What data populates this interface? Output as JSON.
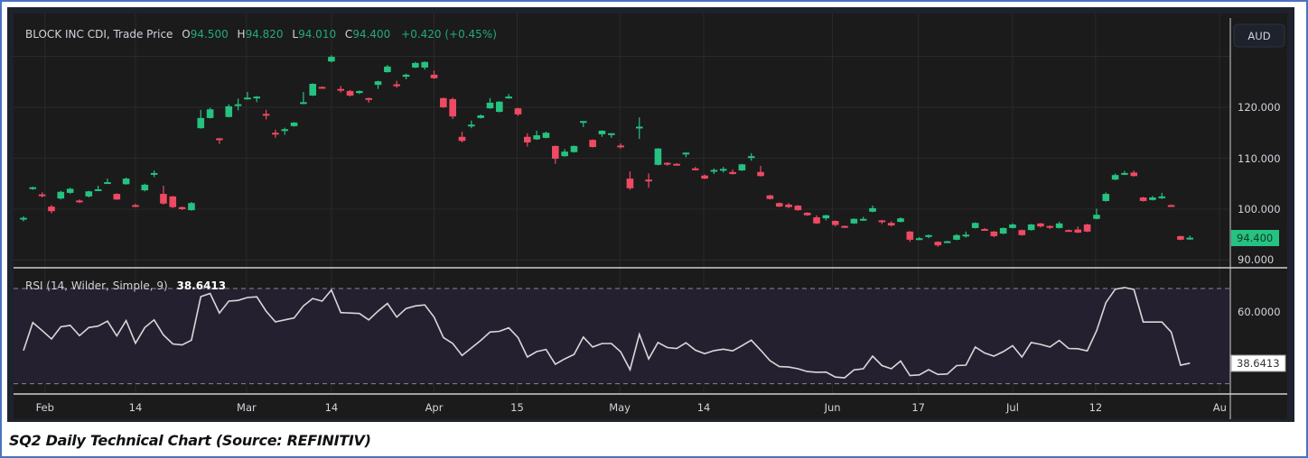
{
  "header": {
    "symbol": "BLOCK INC CDI, Trade Price",
    "o_label": "O",
    "o_value": "94.500",
    "h_label": "H",
    "h_value": "94.820",
    "l_label": "L",
    "l_value": "94.010",
    "c_label": "C",
    "c_value": "94.400",
    "change": "+0.420 (+0.45%)"
  },
  "currency_button": "AUD",
  "price_axis_labels": [
    "120.000",
    "110.000",
    "100.000",
    "90.000"
  ],
  "last_price_tag": "94.400",
  "rsi": {
    "label": "RSI (14, Wilder, Simple, 9)",
    "value": "38.6413",
    "axis_label": "60.0000",
    "tag": "38.6413"
  },
  "caption": "SQ2 Daily Technical Chart (Source: REFINITIV)",
  "colors": {
    "up": "#26c281",
    "down": "#ef4a63",
    "background": "#1b1b1b",
    "rsi_line": "#d8d8d8",
    "rsi_band": "#252030"
  },
  "chart_data": [
    {
      "type": "candlestick",
      "title": "BLOCK INC CDI, Trade Price",
      "ylabel": "AUD",
      "ylim": [
        88,
        134
      ],
      "yticks": [
        90,
        100,
        110,
        120,
        130
      ],
      "x_tick_labels": [
        {
          "label": "Feb",
          "index": 2.3
        },
        {
          "label": "14",
          "index": 12
        },
        {
          "label": "Mar",
          "index": 23.9
        },
        {
          "label": "14",
          "index": 33
        },
        {
          "label": "Apr",
          "index": 44
        },
        {
          "label": "15",
          "index": 52.9
        },
        {
          "label": "May",
          "index": 63.9
        },
        {
          "label": "14",
          "index": 72.9
        },
        {
          "label": "Jun",
          "index": 86.7
        },
        {
          "label": "17",
          "index": 95.9
        },
        {
          "label": "Jul",
          "index": 106
        },
        {
          "label": "12",
          "index": 114.9
        },
        {
          "label": "Au",
          "index": 128.2
        }
      ],
      "ohlc": [
        [
          98.0,
          98.6,
          97.6,
          98.3
        ],
        [
          104.0,
          104.4,
          103.8,
          104.3
        ],
        [
          102.9,
          103.3,
          102.3,
          102.7
        ],
        [
          100.5,
          100.8,
          99.2,
          99.6
        ],
        [
          102.1,
          103.6,
          101.9,
          103.4
        ],
        [
          103.2,
          104.2,
          103.0,
          104.0
        ],
        [
          101.7,
          101.9,
          101.2,
          101.4
        ],
        [
          102.5,
          103.6,
          102.3,
          103.5
        ],
        [
          103.8,
          104.6,
          103.7,
          103.9
        ],
        [
          105.1,
          106.0,
          105.0,
          105.3
        ],
        [
          103.0,
          103.1,
          101.8,
          101.9
        ],
        [
          104.9,
          106.2,
          104.8,
          106.0
        ],
        [
          100.8,
          101.1,
          100.4,
          100.6
        ],
        [
          103.7,
          105.0,
          103.5,
          104.8
        ],
        [
          106.9,
          107.6,
          106.3,
          107.1
        ],
        [
          103.0,
          104.6,
          100.9,
          101.1
        ],
        [
          102.5,
          102.6,
          100.2,
          100.4
        ],
        [
          100.4,
          100.5,
          99.8,
          100.0
        ],
        [
          99.8,
          101.4,
          99.7,
          101.2
        ],
        [
          115.9,
          119.5,
          115.8,
          117.9
        ],
        [
          117.9,
          119.9,
          117.8,
          119.6
        ],
        [
          113.9,
          114.0,
          112.8,
          113.7
        ],
        [
          118.1,
          120.6,
          118.0,
          120.2
        ],
        [
          120.3,
          121.7,
          119.4,
          120.6
        ],
        [
          121.7,
          123.0,
          121.5,
          121.9
        ],
        [
          121.9,
          122.2,
          121.0,
          122.1
        ],
        [
          118.7,
          119.5,
          117.6,
          118.5
        ],
        [
          115.0,
          115.6,
          114.0,
          114.8
        ],
        [
          115.4,
          116.0,
          114.6,
          115.7
        ],
        [
          116.3,
          117.1,
          116.2,
          117.0
        ],
        [
          120.7,
          123.0,
          120.6,
          121.0
        ],
        [
          122.3,
          124.7,
          122.2,
          124.6
        ],
        [
          124.0,
          124.1,
          123.7,
          123.8
        ],
        [
          129.0,
          130.2,
          128.8,
          129.9
        ],
        [
          123.6,
          124.2,
          122.9,
          123.4
        ],
        [
          123.2,
          123.4,
          122.1,
          122.3
        ],
        [
          122.8,
          123.3,
          122.6,
          123.2
        ],
        [
          121.8,
          121.9,
          120.9,
          121.6
        ],
        [
          124.4,
          125.2,
          123.6,
          125.1
        ],
        [
          126.9,
          128.3,
          126.8,
          128.0
        ],
        [
          124.5,
          125.2,
          123.8,
          124.3
        ],
        [
          126.0,
          126.6,
          125.5,
          126.4
        ],
        [
          127.8,
          128.9,
          127.7,
          128.7
        ],
        [
          127.8,
          129.0,
          127.4,
          128.9
        ],
        [
          126.4,
          127.2,
          125.6,
          125.7
        ],
        [
          121.8,
          121.9,
          119.9,
          120.0
        ],
        [
          121.6,
          121.9,
          117.7,
          118.2
        ],
        [
          114.2,
          115.2,
          113.1,
          113.4
        ],
        [
          116.5,
          117.4,
          115.9,
          116.6
        ],
        [
          117.9,
          118.6,
          117.8,
          118.4
        ],
        [
          119.8,
          121.8,
          119.7,
          120.9
        ],
        [
          119.1,
          121.2,
          119.0,
          121.1
        ],
        [
          121.9,
          122.6,
          121.7,
          122.1
        ],
        [
          119.8,
          119.9,
          118.3,
          118.6
        ],
        [
          114.2,
          114.9,
          112.3,
          113.1
        ],
        [
          113.7,
          115.4,
          113.6,
          114.5
        ],
        [
          114.0,
          115.2,
          113.9,
          115.0
        ],
        [
          112.4,
          112.5,
          108.9,
          109.9
        ],
        [
          110.4,
          111.8,
          110.3,
          111.3
        ],
        [
          111.2,
          112.5,
          111.1,
          112.4
        ],
        [
          117.1,
          117.3,
          116.1,
          117.3
        ],
        [
          113.6,
          113.7,
          112.1,
          112.2
        ],
        [
          114.7,
          115.5,
          114.2,
          115.4
        ],
        [
          114.7,
          114.9,
          114.0,
          114.9
        ],
        [
          112.5,
          112.9,
          111.9,
          112.3
        ],
        [
          106.0,
          107.4,
          103.8,
          104.1
        ],
        [
          116.0,
          118.0,
          113.8,
          116.2
        ],
        [
          105.8,
          107.0,
          104.2,
          105.6
        ],
        [
          108.7,
          112.0,
          108.6,
          111.9
        ],
        [
          109.1,
          109.2,
          108.5,
          108.9
        ],
        [
          108.9,
          109.0,
          108.6,
          108.7
        ],
        [
          111.0,
          111.1,
          110.2,
          111.1
        ],
        [
          108.0,
          108.3,
          107.6,
          107.9
        ],
        [
          106.6,
          106.8,
          105.9,
          106.0
        ],
        [
          107.5,
          108.0,
          106.9,
          107.7
        ],
        [
          107.7,
          108.3,
          107.2,
          107.9
        ],
        [
          107.3,
          107.8,
          106.8,
          106.9
        ],
        [
          107.6,
          108.9,
          107.5,
          108.8
        ],
        [
          110.2,
          111.0,
          109.5,
          110.4
        ],
        [
          107.3,
          108.5,
          106.4,
          106.5
        ],
        [
          102.7,
          102.8,
          101.9,
          102.0
        ],
        [
          101.2,
          101.3,
          100.4,
          100.5
        ],
        [
          100.9,
          101.2,
          100.2,
          100.4
        ],
        [
          100.7,
          100.8,
          99.7,
          99.8
        ],
        [
          99.3,
          99.4,
          98.7,
          98.8
        ],
        [
          98.4,
          98.8,
          97.1,
          97.2
        ],
        [
          98.2,
          98.9,
          97.8,
          98.8
        ],
        [
          97.7,
          97.8,
          96.6,
          96.9
        ],
        [
          96.7,
          96.8,
          96.3,
          96.5
        ],
        [
          97.2,
          98.2,
          97.1,
          98.1
        ],
        [
          98.0,
          98.5,
          97.7,
          98.1
        ],
        [
          99.5,
          100.7,
          99.4,
          100.2
        ],
        [
          97.8,
          97.9,
          97.1,
          97.7
        ],
        [
          97.3,
          97.6,
          96.6,
          96.8
        ],
        [
          97.5,
          98.4,
          97.4,
          98.2
        ],
        [
          95.6,
          95.7,
          93.6,
          94.0
        ],
        [
          94.1,
          94.5,
          93.9,
          94.3
        ],
        [
          94.9,
          95.0,
          94.3,
          94.9
        ],
        [
          93.6,
          93.7,
          92.6,
          92.9
        ],
        [
          93.5,
          93.8,
          93.4,
          93.7
        ],
        [
          94.0,
          95.1,
          93.9,
          94.9
        ],
        [
          94.8,
          95.6,
          94.4,
          95.0
        ],
        [
          96.3,
          97.4,
          96.2,
          97.3
        ],
        [
          96.1,
          96.3,
          95.8,
          96.0
        ],
        [
          95.6,
          95.7,
          94.5,
          94.7
        ],
        [
          95.2,
          96.4,
          95.1,
          96.3
        ],
        [
          96.3,
          97.2,
          96.2,
          97.0
        ],
        [
          95.9,
          96.0,
          94.8,
          94.9
        ],
        [
          95.9,
          97.1,
          95.8,
          97.0
        ],
        [
          97.2,
          97.3,
          96.4,
          96.6
        ],
        [
          96.7,
          96.8,
          96.1,
          96.5
        ],
        [
          96.3,
          97.5,
          96.2,
          97.2
        ],
        [
          95.9,
          96.0,
          95.7,
          95.8
        ],
        [
          96.0,
          96.6,
          95.3,
          95.4
        ],
        [
          97.0,
          97.1,
          95.5,
          95.6
        ],
        [
          98.1,
          100.1,
          98.0,
          98.9
        ],
        [
          101.6,
          103.3,
          101.5,
          103.0
        ],
        [
          105.8,
          107.0,
          105.7,
          106.7
        ],
        [
          107.0,
          107.5,
          106.7,
          107.1
        ],
        [
          107.2,
          107.6,
          106.4,
          106.5
        ],
        [
          102.3,
          102.4,
          101.5,
          101.6
        ],
        [
          101.8,
          102.6,
          101.7,
          102.3
        ],
        [
          102.4,
          103.2,
          102.0,
          102.5
        ],
        [
          100.8,
          100.9,
          100.5,
          100.6
        ],
        [
          94.7,
          94.8,
          93.9,
          94.0
        ],
        [
          94.3,
          94.82,
          94.01,
          94.4
        ]
      ]
    },
    {
      "type": "line",
      "title": "RSI (14, Wilder, Simple, 9)",
      "ylim": [
        25,
        75
      ],
      "bands": [
        30,
        70
      ],
      "yticks": [
        60
      ],
      "values": [
        43.9,
        55.7,
        52.3,
        48.8,
        53.9,
        54.5,
        50.2,
        53.6,
        54.2,
        56.3,
        50.1,
        56.5,
        47.0,
        53.6,
        56.8,
        50.5,
        46.7,
        46.3,
        48.3,
        66.6,
        67.9,
        59.7,
        64.7,
        65.0,
        66.2,
        66.5,
        60.5,
        56.0,
        56.8,
        57.6,
        62.7,
        65.8,
        64.7,
        69.4,
        59.9,
        59.7,
        59.5,
        56.8,
        60.5,
        63.7,
        58.0,
        61.6,
        62.7,
        63.1,
        58.0,
        49.4,
        46.9,
        41.9,
        45.0,
        48.2,
        51.7,
        52.0,
        53.5,
        49.4,
        41.2,
        43.5,
        44.4,
        38.2,
        40.4,
        42.3,
        49.6,
        45.4,
        46.9,
        46.9,
        43.4,
        35.9,
        50.8,
        40.4,
        47.3,
        45.2,
        44.8,
        47.2,
        44.1,
        42.6,
        43.9,
        44.5,
        43.8,
        46.0,
        48.3,
        44.1,
        39.7,
        37.2,
        37.0,
        36.3,
        35.1,
        34.8,
        34.9,
        32.8,
        32.5,
        35.8,
        36.3,
        41.6,
        37.6,
        36.3,
        39.5,
        33.4,
        33.7,
        35.9,
        33.9,
        34.1,
        37.6,
        37.8,
        45.4,
        42.9,
        41.6,
        43.5,
        46.0,
        41.2,
        47.3,
        46.5,
        45.4,
        48.2,
        44.8,
        44.7,
        43.8,
        52.3,
        64.1,
        69.7,
        70.4,
        69.6,
        55.9,
        55.9,
        55.9,
        51.7,
        37.8,
        38.6413
      ]
    }
  ]
}
